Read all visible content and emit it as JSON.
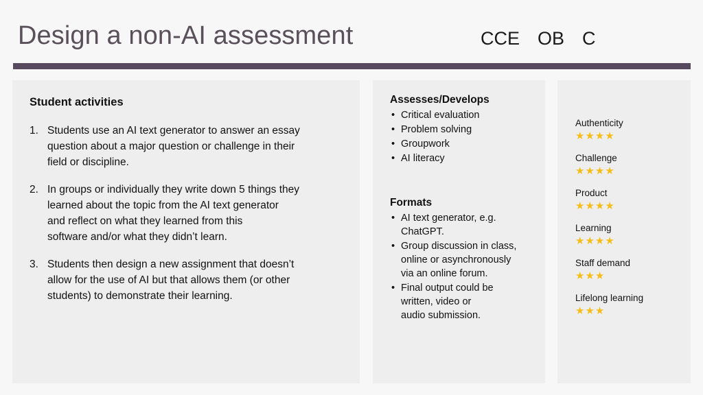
{
  "header": {
    "title": "Design a non-AI assessment",
    "codes": [
      "CCE",
      "OB",
      "C"
    ],
    "rule_color": "#584a5e",
    "title_color": "#59505a"
  },
  "panels": {
    "activities": {
      "heading": "Student activities",
      "items": [
        {
          "number": "1.",
          "text": "Students use an AI text generator to answer an essay\nquestion about a major question or challenge in their\nfield or discipline."
        },
        {
          "number": "2.",
          "text": "In groups or individually they write down 5 things they\nlearned about the topic from the AI text generator\nand reflect on what they learned from this\nsoftware and/or what they didn’t learn."
        },
        {
          "number": "3.",
          "text": "Students then design a new assignment that doesn’t\nallow for the use of AI but that allows them (or other\nstudents) to demonstrate their learning."
        }
      ]
    },
    "assesses": {
      "heading": "Assesses/Develops",
      "bullets": [
        "Critical evaluation",
        "Problem solving",
        "Groupwork",
        "AI literacy"
      ]
    },
    "formats": {
      "heading": "Formats",
      "bullets": [
        "AI text generator, e.g.\nChatGPT.",
        "Group discussion in class,\nonline or asynchronously\nvia an online forum.",
        "Final output could be\nwritten, video or\naudio submission."
      ]
    },
    "ratings": {
      "star_color": "#f5bd17",
      "max_stars": 5,
      "items": [
        {
          "label": "Authenticity",
          "stars": 4,
          "stars_text": "★★★★"
        },
        {
          "label": "Challenge",
          "stars": 4,
          "stars_text": "★★★★"
        },
        {
          "label": "Product",
          "stars": 4,
          "stars_text": "★★★★"
        },
        {
          "label": "Learning",
          "stars": 4,
          "stars_text": "★★★★"
        },
        {
          "label": "Staff demand",
          "stars": 3,
          "stars_text": "★★★"
        },
        {
          "label": "Lifelong learning",
          "stars": 3,
          "stars_text": "★★★"
        }
      ]
    }
  }
}
